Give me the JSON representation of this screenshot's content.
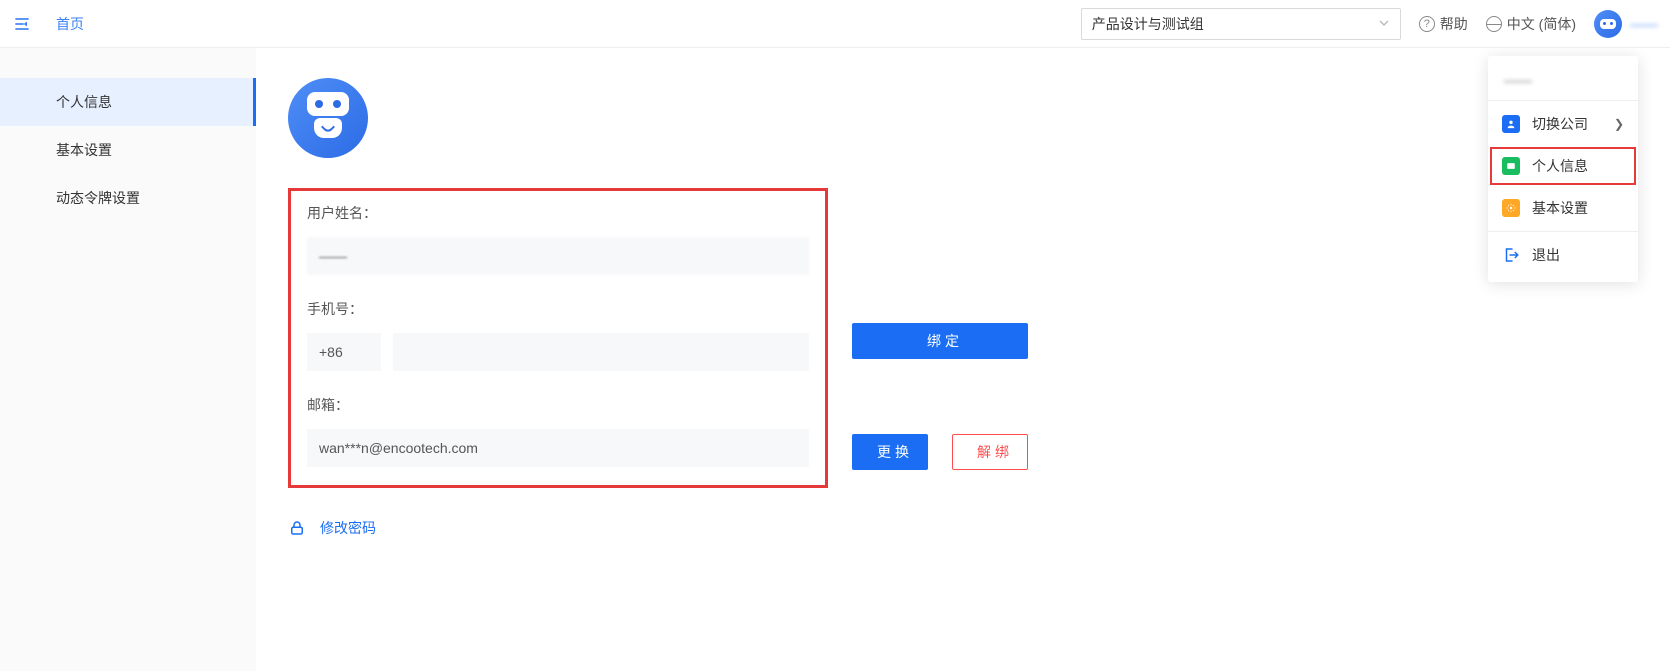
{
  "header": {
    "home": "首页",
    "org_selected": "产品设计与测试组",
    "help": "帮助",
    "language": "中文 (简体)",
    "username_short": "——"
  },
  "sidebar": {
    "items": [
      {
        "label": "个人信息",
        "active": true
      },
      {
        "label": "基本设置",
        "active": false
      },
      {
        "label": "动态令牌设置",
        "active": false
      }
    ]
  },
  "form": {
    "username_label": "用户姓名：",
    "username_value": "——",
    "phone_label": "手机号：",
    "phone_prefix": "+86",
    "phone_value": "",
    "bind_button": "绑定",
    "email_label": "邮箱：",
    "email_value": "wan***n@encootech.com",
    "change_button": "更换",
    "unbind_button": "解绑",
    "change_password": "修改密码"
  },
  "user_menu": {
    "header": "——",
    "switch_company": "切换公司",
    "personal_info": "个人信息",
    "basic_settings": "基本设置",
    "logout": "退出"
  }
}
